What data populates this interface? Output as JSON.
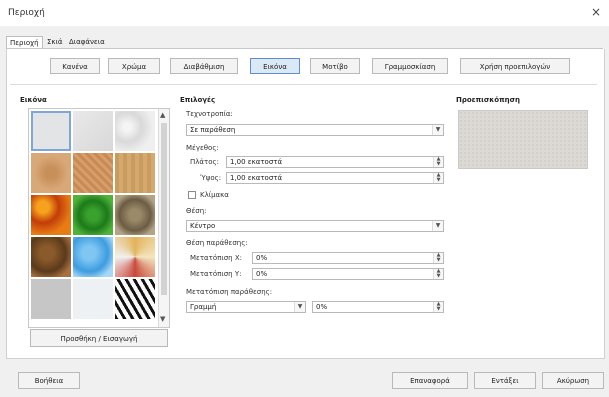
{
  "window": {
    "title": "Περιοχή",
    "close": "×"
  },
  "tabs": [
    "Περιοχή",
    "Σκιά",
    "Διαφάνεια"
  ],
  "fill_buttons": [
    "Κανένα",
    "Χρώμα",
    "Διαβάθμιση",
    "Εικόνα",
    "Μοτίβο",
    "Γραμμοσκίαση",
    "Χρήση προεπιλογών"
  ],
  "image_section": {
    "heading": "Εικόνα",
    "import_button": "Προσθήκη / Εισαγωγή"
  },
  "options": {
    "heading": "Επιλογές",
    "style_label": "Τεχνοτροπία:",
    "style_value": "Σε παράθεση",
    "size_label": "Μέγεθος:",
    "width_label": "Πλάτος:",
    "width_value": "1,00 εκατοστά",
    "height_label": "Ύψος:",
    "height_value": "1,00 εκατοστά",
    "scale_label": "Κλίμακα",
    "position_label": "Θέση:",
    "position_value": "Κέντρο",
    "tile_position_label": "Θέση παράθεσης:",
    "offset_x_label": "Μετατόπιση Χ:",
    "offset_x_value": "0%",
    "offset_y_label": "Μετατόπιση Υ:",
    "offset_y_value": "0%",
    "tile_offset_label": "Μετατόπιση παράθεσης:",
    "tile_offset_type": "Γραμμή",
    "tile_offset_value": "0%"
  },
  "preview": {
    "heading": "Προεπισκόπηση"
  },
  "footer": {
    "help": "Βοήθεια",
    "reset": "Επαναφορά",
    "ok": "Εντάξει",
    "cancel": "Ακύρωση"
  },
  "colors": {
    "accent": "#5d8fc8",
    "selected_tile": "#7ea6d9"
  }
}
